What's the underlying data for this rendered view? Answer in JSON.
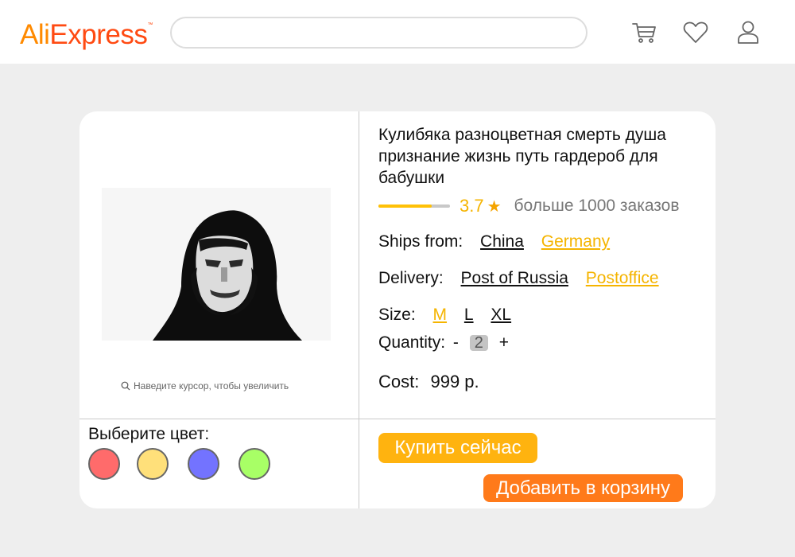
{
  "header": {
    "logo_part1": "Ali",
    "logo_part2": "Express",
    "logo_tm": "™",
    "search_value": "",
    "icons": [
      "cart-icon",
      "heart-icon",
      "user-icon"
    ]
  },
  "product": {
    "title": "Кулибяка разноцветная смерть душа признание жизнь путь гардероб для бабушки",
    "rating": 3.7,
    "rating_text": "3.7",
    "rating_max": 5,
    "orders": "больше 1000 заказов",
    "ships_from": {
      "label": "Ships from:",
      "options": [
        {
          "label": "China",
          "selected": false
        },
        {
          "label": "Germany",
          "selected": true
        }
      ]
    },
    "delivery": {
      "label": "Delivery:",
      "options": [
        {
          "label": "Post of Russia",
          "selected": false
        },
        {
          "label": "Postoffice",
          "selected": true
        }
      ]
    },
    "size": {
      "label": "Size:",
      "options": [
        {
          "label": "M",
          "selected": true
        },
        {
          "label": "L",
          "selected": false
        },
        {
          "label": "XL",
          "selected": false
        }
      ]
    },
    "quantity": {
      "label": "Quantity:",
      "minus": "-",
      "value": "2",
      "plus": "+"
    },
    "cost": {
      "label": "Cost:",
      "value": "999 р."
    }
  },
  "gallery": {
    "zoom_hint": "Наведите курсор, чтобы увеличить"
  },
  "colors": {
    "title": "Выберите цвет:",
    "swatches": [
      "#ff6b6b",
      "#ffe07a",
      "#7373ff",
      "#a8ff66"
    ]
  },
  "actions": {
    "buy_now": "Купить сейчас",
    "add_to_cart": "Добавить в корзину"
  },
  "theme": {
    "accent_yellow": "#ffb30f",
    "accent_orange": "#ff7a1a",
    "selected_text": "#f5b400"
  }
}
